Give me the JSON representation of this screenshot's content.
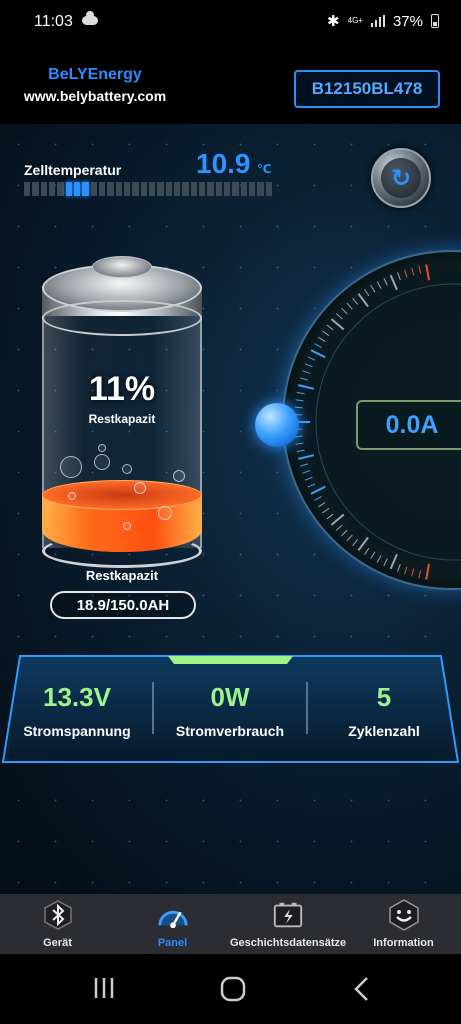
{
  "status_bar": {
    "time": "11:03",
    "network": "4G+",
    "battery_percent": "37%"
  },
  "header": {
    "brand_name": "BeLYEnergy",
    "website": "www.belybattery.com",
    "device_id": "B12150BL478"
  },
  "temperature": {
    "label": "Zelltemperatur",
    "value": "10.9",
    "unit": "℃",
    "bar_fill_fraction": 0.27
  },
  "battery": {
    "percent": "11%",
    "percent_label": "Restkapazit",
    "caption": "Restkapazit",
    "capacity": "18.9/150.0AH"
  },
  "gauge": {
    "current": "0.0A"
  },
  "stats": [
    {
      "value": "13.3V",
      "label": "Stromspannung"
    },
    {
      "value": "0W",
      "label": "Stromverbrauch"
    },
    {
      "value": "5",
      "label": "Zyklenzahl"
    }
  ],
  "nav": {
    "items": [
      {
        "label": "Gerät",
        "icon": "bluetooth-icon"
      },
      {
        "label": "Panel",
        "icon": "speedometer-icon"
      },
      {
        "label": "Geschichtsdatensätze",
        "icon": "battery-history-icon"
      },
      {
        "label": "Information",
        "icon": "smiley-icon"
      }
    ],
    "active_index": 1
  },
  "colors": {
    "accent": "#2c8fff",
    "stat_value": "#9cf48a",
    "fluid": "#ff5a1a"
  }
}
